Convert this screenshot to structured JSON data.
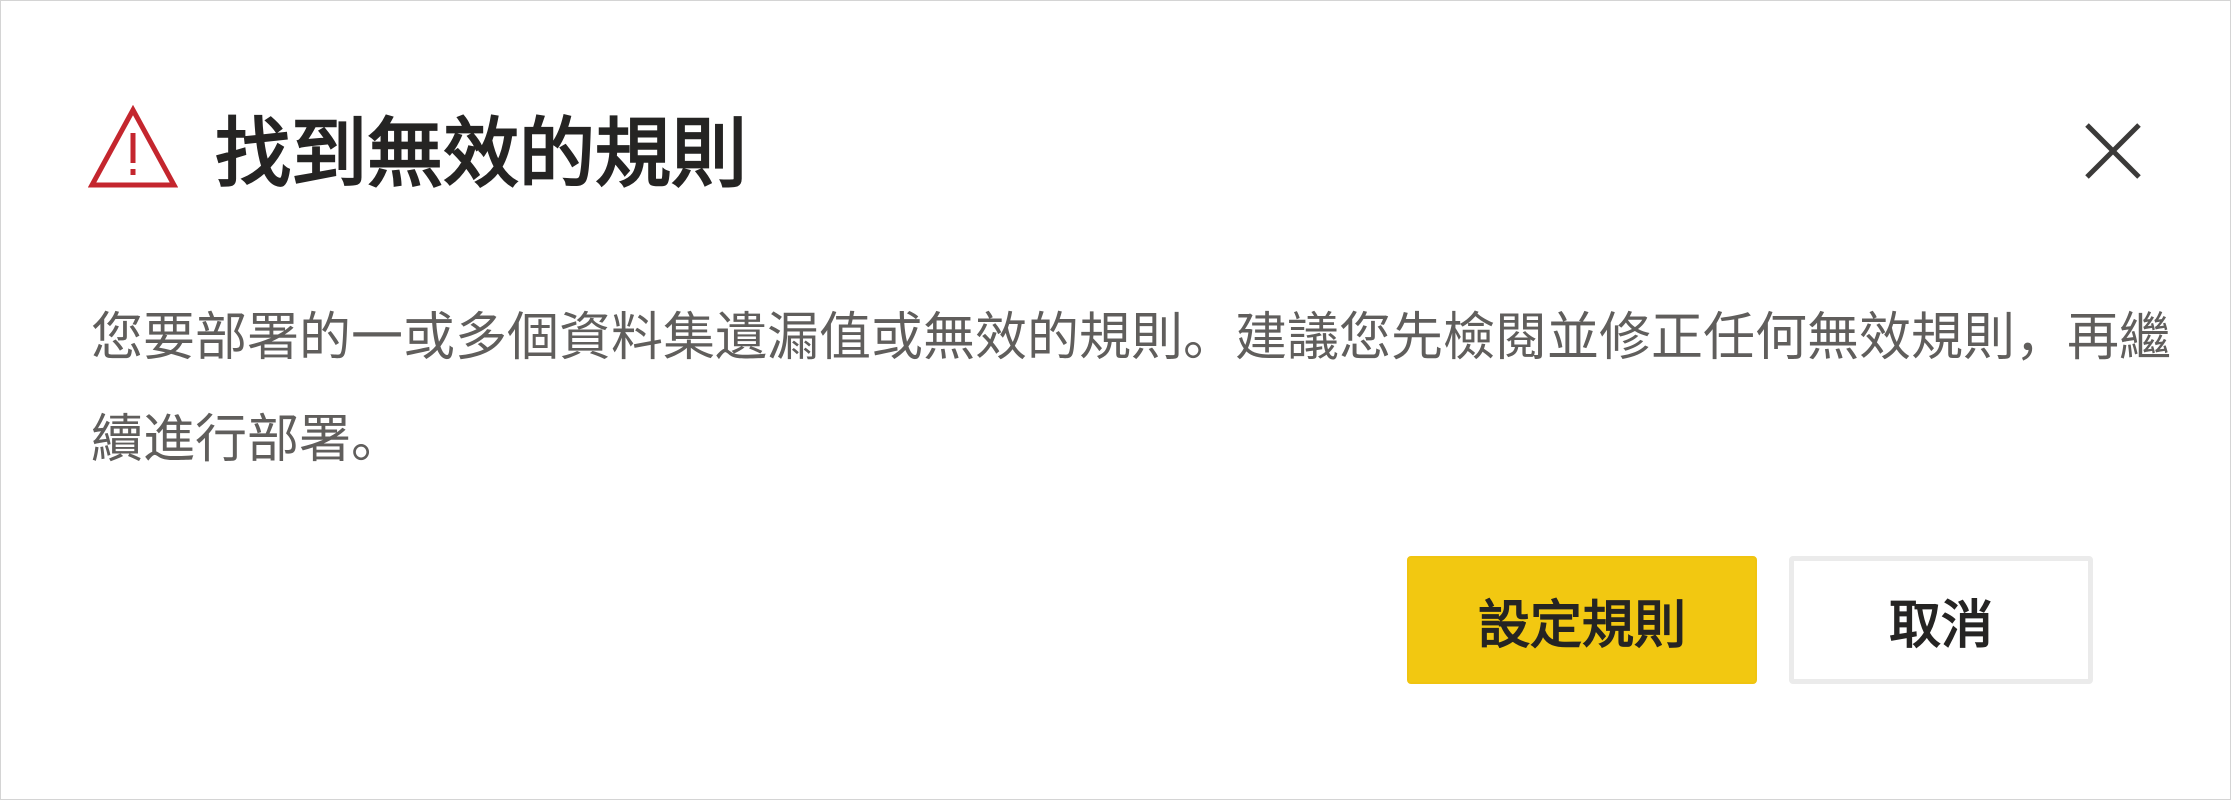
{
  "dialog": {
    "title": "找到無效的規則",
    "message": "您要部署的一或多個資料集遺漏值或無效的規則。建議您先檢閱並修正任何無效規則，再繼續進行部署。",
    "icons": {
      "warning": "warning-triangle-icon",
      "close": "close-icon"
    },
    "colors": {
      "warning": "#c4262e",
      "primary_button": "#f2c811",
      "text": "#252423",
      "message_text": "#605e5c"
    }
  },
  "buttons": {
    "primary_label": "設定規則",
    "cancel_label": "取消"
  }
}
